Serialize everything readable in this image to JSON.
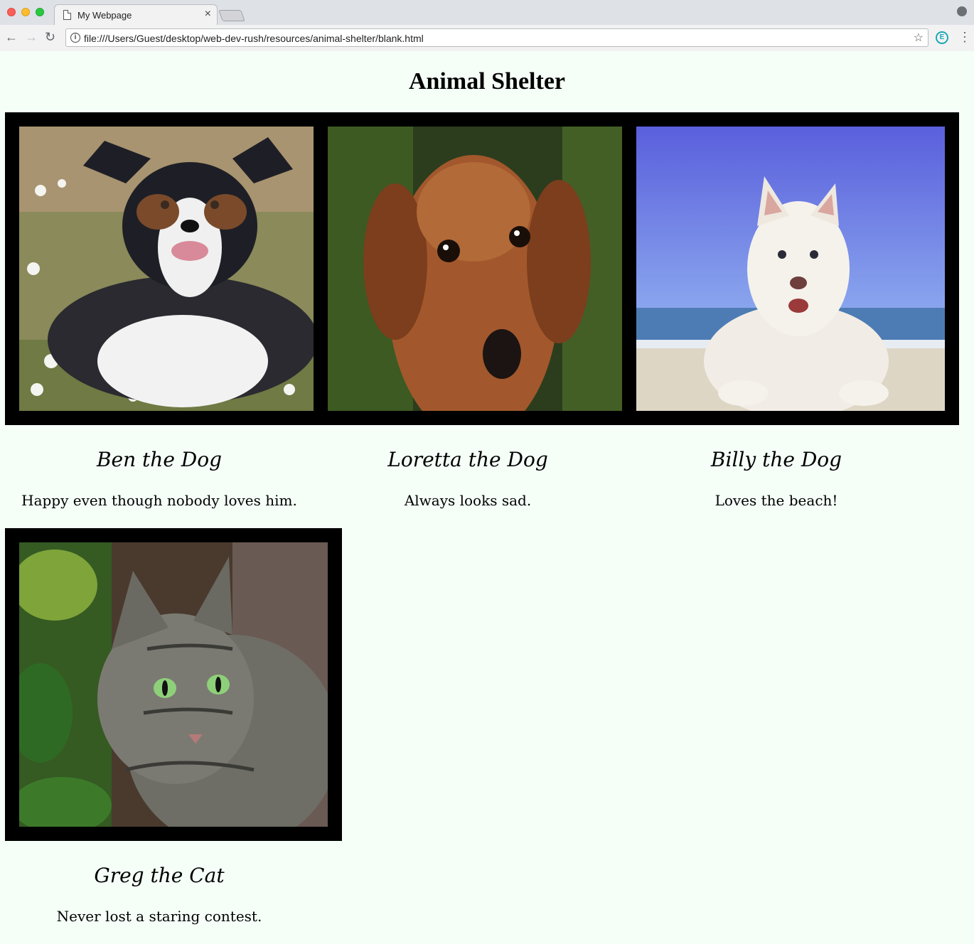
{
  "browser": {
    "tab_title": "My Webpage",
    "tab_close": "×",
    "url": "file:///Users/Guest/desktop/web-dev-rush/resources/animal-shelter/blank.html",
    "back": "←",
    "forward": "→",
    "reload": "↻",
    "info": "i",
    "star": "☆",
    "extension": "E",
    "menu": "⋮"
  },
  "page": {
    "title": "Animal Shelter"
  },
  "pets": [
    {
      "name": "Ben the Dog",
      "description": "Happy even though nobody loves him."
    },
    {
      "name": "Loretta the Dog",
      "description": "Always looks sad."
    },
    {
      "name": "Billy the Dog",
      "description": "Loves the beach!"
    },
    {
      "name": "Greg the Cat",
      "description": "Never lost a staring contest."
    }
  ],
  "colors": {
    "page_background": "#f5fff8",
    "frame": "#000000"
  }
}
